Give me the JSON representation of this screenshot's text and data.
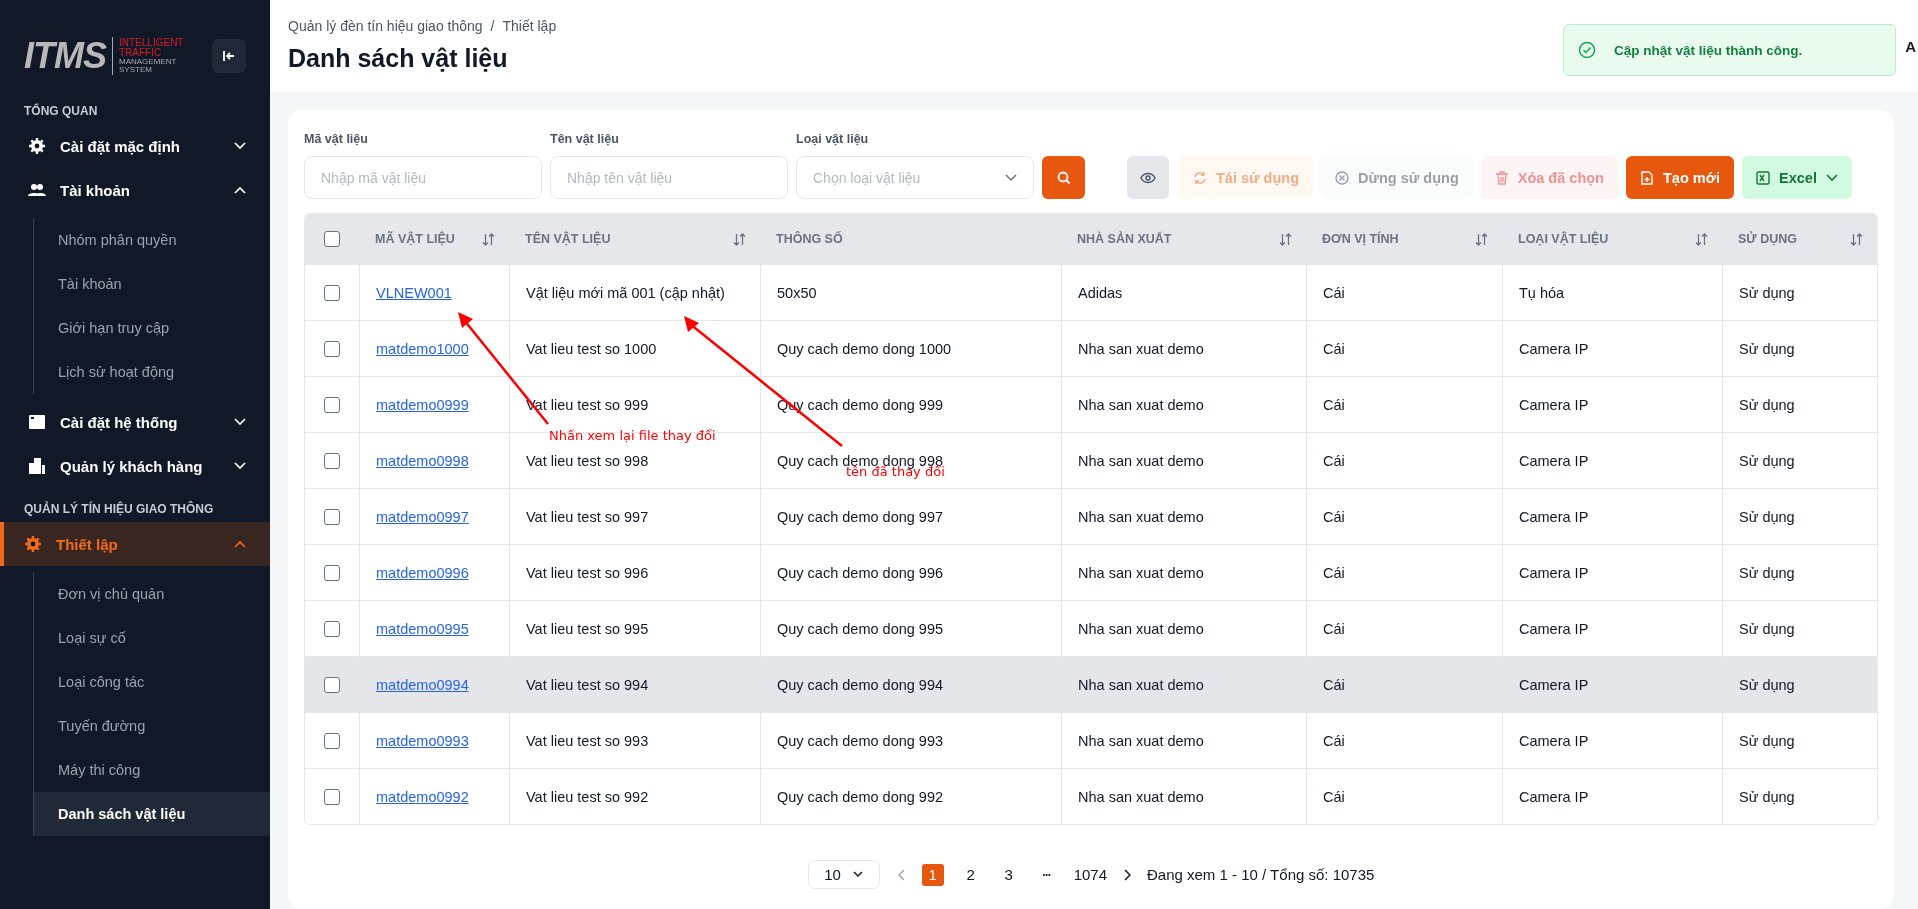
{
  "logo": {
    "mark": "ITMS",
    "tagline": [
      "INTELLIGENT",
      "TRAFFIC",
      "MANAGEMENT",
      "SYSTEM"
    ]
  },
  "sidebar": [
    {
      "kind": "section",
      "label": "TỔNG QUAN"
    },
    {
      "kind": "group",
      "label": "Cài đặt mặc định",
      "expanded": false,
      "selected": false
    },
    {
      "kind": "group",
      "label": "Tài khoản",
      "expanded": true,
      "selected": false,
      "children": [
        {
          "label": "Nhóm phân quyền",
          "selected": false
        },
        {
          "label": "Tài khoản",
          "selected": false
        },
        {
          "label": "Giới hạn truy cập",
          "selected": false
        },
        {
          "label": "Lịch sử hoạt động",
          "selected": false
        }
      ]
    },
    {
      "kind": "group",
      "label": "Cài đặt hệ thống",
      "expanded": false,
      "selected": false
    },
    {
      "kind": "group",
      "label": "Quản lý khách hàng",
      "expanded": false,
      "selected": false
    },
    {
      "kind": "section",
      "label": "QUẢN LÝ TÍN HIỆU GIAO THÔNG"
    },
    {
      "kind": "group",
      "label": "Thiết lập",
      "expanded": true,
      "selected": true,
      "children": [
        {
          "label": "Đơn vị chủ quản",
          "selected": false
        },
        {
          "label": "Loại sự cố",
          "selected": false
        },
        {
          "label": "Loại công tác",
          "selected": false
        },
        {
          "label": "Tuyến đường",
          "selected": false
        },
        {
          "label": "Máy thi công",
          "selected": false
        },
        {
          "label": "Danh sách vật liệu",
          "selected": true
        }
      ]
    }
  ],
  "breadcrumb": [
    "Quản lý đèn tín hiệu giao thông",
    "Thiết lập"
  ],
  "breadcrumb_separator": "/",
  "page_title": "Danh sách vật liệu",
  "user_name_fragment": "A",
  "toast": {
    "message": "Cập nhật vật liệu thành công."
  },
  "filters": [
    {
      "kind": "input",
      "label": "Mã vật liệu",
      "placeholder": "Nhập mã vật liệu"
    },
    {
      "kind": "input",
      "label": "Tên vật liệu",
      "placeholder": "Nhập tên vật liệu"
    },
    {
      "kind": "select",
      "label": "Loại vật liệu",
      "placeholder": "Chọn loại vật liệu"
    }
  ],
  "actions": [
    {
      "kind": "eye"
    },
    {
      "kind": "reuse",
      "label": "Tái sử dụng",
      "disabled": true
    },
    {
      "kind": "stop",
      "label": "Dừng sử dụng",
      "disabled": true
    },
    {
      "kind": "delete",
      "label": "Xóa đã chọn",
      "disabled": true
    },
    {
      "kind": "create",
      "label": "Tạo mới",
      "disabled": false
    },
    {
      "kind": "excel",
      "label": "Excel",
      "disabled": false
    }
  ],
  "table": {
    "select_all_checked": false,
    "columns": [
      {
        "label": "MÃ VẬT LIỆU",
        "sortable": true
      },
      {
        "label": "TÊN VẬT LIỆU",
        "sortable": true
      },
      {
        "label": "THÔNG SỐ",
        "sortable": false
      },
      {
        "label": "NHÀ SẢN XUẤT",
        "sortable": true
      },
      {
        "label": "ĐƠN VỊ TÍNH",
        "sortable": true
      },
      {
        "label": "LOẠI VẬT LIỆU",
        "sortable": true
      },
      {
        "label": "SỬ DỤNG",
        "sortable": true
      }
    ],
    "rows": [
      {
        "checked": false,
        "hovered": false,
        "cells": [
          "VLNEW001",
          "Vật liệu mới mã 001 (cập nhật)",
          "50x50",
          "Adidas",
          "Cái",
          "Tụ hóa",
          "Sử dụng"
        ]
      },
      {
        "checked": false,
        "hovered": false,
        "cells": [
          "matdemo1000",
          "Vat lieu test so 1000",
          "Quy cach demo dong 1000",
          "Nha san xuat demo",
          "Cái",
          "Camera IP",
          "Sử dụng"
        ]
      },
      {
        "checked": false,
        "hovered": false,
        "cells": [
          "matdemo0999",
          "Vat lieu test so 999",
          "Quy cach demo dong 999",
          "Nha san xuat demo",
          "Cái",
          "Camera IP",
          "Sử dụng"
        ]
      },
      {
        "checked": false,
        "hovered": false,
        "cells": [
          "matdemo0998",
          "Vat lieu test so 998",
          "Quy cach demo dong 998",
          "Nha san xuat demo",
          "Cái",
          "Camera IP",
          "Sử dụng"
        ]
      },
      {
        "checked": false,
        "hovered": false,
        "cells": [
          "matdemo0997",
          "Vat lieu test so 997",
          "Quy cach demo dong 997",
          "Nha san xuat demo",
          "Cái",
          "Camera IP",
          "Sử dụng"
        ]
      },
      {
        "checked": false,
        "hovered": false,
        "cells": [
          "matdemo0996",
          "Vat lieu test so 996",
          "Quy cach demo dong 996",
          "Nha san xuat demo",
          "Cái",
          "Camera IP",
          "Sử dụng"
        ]
      },
      {
        "checked": false,
        "hovered": false,
        "cells": [
          "matdemo0995",
          "Vat lieu test so 995",
          "Quy cach demo dong 995",
          "Nha san xuat demo",
          "Cái",
          "Camera IP",
          "Sử dụng"
        ]
      },
      {
        "checked": false,
        "hovered": true,
        "cells": [
          "matdemo0994",
          "Vat lieu test so 994",
          "Quy cach demo dong 994",
          "Nha san xuat demo",
          "Cái",
          "Camera IP",
          "Sử dụng"
        ]
      },
      {
        "checked": false,
        "hovered": false,
        "cells": [
          "matdemo0993",
          "Vat lieu test so 993",
          "Quy cach demo dong 993",
          "Nha san xuat demo",
          "Cái",
          "Camera IP",
          "Sử dụng"
        ]
      },
      {
        "checked": false,
        "hovered": false,
        "cells": [
          "matdemo0992",
          "Vat lieu test so 992",
          "Quy cach demo dong 992",
          "Nha san xuat demo",
          "Cái",
          "Camera IP",
          "Sử dụng"
        ]
      }
    ]
  },
  "pagination": {
    "page_size": "10",
    "pages": [
      {
        "label": "1",
        "selected": true
      },
      {
        "label": "2",
        "selected": false
      },
      {
        "label": "3",
        "selected": false
      }
    ],
    "ellipsis": "•••",
    "last_page": "1074",
    "info": "Đang xem 1 - 10 / Tổng số: 10735"
  },
  "annotations": [
    {
      "text": "Nhấn xem lại file thay đổi"
    },
    {
      "text": "tên đã thay đổi"
    }
  ]
}
